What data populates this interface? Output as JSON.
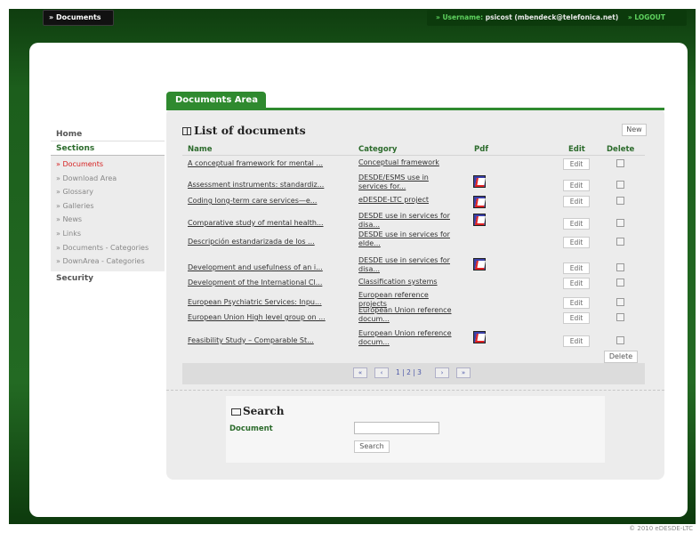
{
  "topbar": {
    "tab_label": "» Documents",
    "username_label": "» Username:",
    "username_value": "psicost (mbendeck@telefonica.net)",
    "logout_label": "» LOGOUT"
  },
  "sidebar": {
    "home": "Home",
    "sections": "Sections",
    "items": [
      {
        "label": "» Documents"
      },
      {
        "label": "» Download Area"
      },
      {
        "label": "» Glossary"
      },
      {
        "label": "» Galleries"
      },
      {
        "label": "» News"
      },
      {
        "label": "» Links"
      },
      {
        "label": "» Documents - Categories"
      },
      {
        "label": "» DownArea - Categories"
      }
    ],
    "security": "Security"
  },
  "area": {
    "tab_label": "Documents Area",
    "list_title": "List of documents",
    "new_button": "New",
    "columns": {
      "name": "Name",
      "category": "Category",
      "pdf": "Pdf",
      "edit": "Edit",
      "delete": "Delete"
    },
    "edit_label": "Edit",
    "rows": [
      {
        "name": "A conceptual framework for mental ...",
        "category": "Conceptual framework",
        "pdf": false
      },
      {
        "name": "Assessment instruments: standardiz...",
        "category": "DESDE/ESMS use in services for...",
        "pdf": true
      },
      {
        "name": "Coding long-term care services—e...",
        "category": "eDESDE-LTC project",
        "pdf": true
      },
      {
        "name": "Comparative study of mental health...",
        "category": "DESDE use in services for disa...",
        "pdf": true
      },
      {
        "name": "Descripción estandarizada de los ...",
        "category": "DESDE use in services for elde...",
        "pdf": false
      },
      {
        "name": "Development and usefulness of an i...",
        "category": "DESDE use in services for disa...",
        "pdf": true
      },
      {
        "name": "Development of the International Cl...",
        "category": "Classification systems",
        "pdf": false
      },
      {
        "name": "European Psychiatric Services: Inpu...",
        "category": "European reference projects",
        "pdf": false
      },
      {
        "name": "European Union High level group on ...",
        "category": "European Union reference docum...",
        "pdf": false
      },
      {
        "name": "Feasibility Study – Comparable St...",
        "category": "European Union reference docum...",
        "pdf": true
      }
    ],
    "delete_button": "Delete",
    "pager": {
      "first": "«",
      "prev": "‹",
      "pages": "1 | 2 | 3",
      "next": "›",
      "last": "»"
    }
  },
  "search": {
    "title": "Search",
    "document_label": "Document",
    "document_value": "",
    "button": "Search"
  },
  "footer": "© 2010 eDESDE-LTC",
  "colors": {
    "brand_green": "#2f8a2f",
    "dark_green": "#1d5a1d",
    "active_red": "#d62020"
  }
}
